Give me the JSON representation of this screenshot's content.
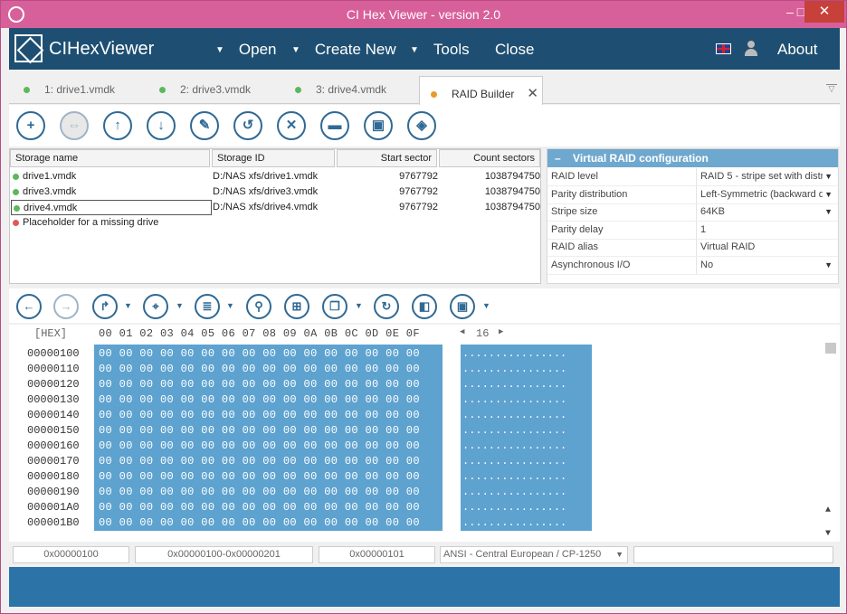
{
  "window": {
    "title": "CI Hex Viewer - version 2.0",
    "min": "–",
    "max": "□",
    "close": "✕"
  },
  "menubar": {
    "brand": "CIHexViewer",
    "open": "Open",
    "create_new": "Create New",
    "tools": "Tools",
    "close": "Close",
    "about": "About",
    "caret": "▼"
  },
  "tabs": [
    {
      "label": "1: drive1.vmdk"
    },
    {
      "label": "2: drive3.vmdk"
    },
    {
      "label": "3: drive4.vmdk"
    },
    {
      "label": "RAID Builder",
      "close": "✕"
    }
  ],
  "raid_toolbar": {
    "icons": [
      "plus-icon",
      "link-icon",
      "arrow-up-icon",
      "arrow-down-icon",
      "edit-icon",
      "undo-icon",
      "remove-icon",
      "folder-icon",
      "save-icon",
      "layers-icon"
    ],
    "glyphs": [
      "+",
      "⇔",
      "↑",
      "↓",
      "✎",
      "↺",
      "✕",
      "▬",
      "▣",
      "◈"
    ]
  },
  "storage_grid": {
    "headers": [
      "Storage name",
      "Storage ID",
      "Start sector",
      "Count sectors"
    ],
    "rows": [
      {
        "name": "drive1.vmdk",
        "id": "D:/NAS xfs/drive1.vmdk",
        "start": "9767792",
        "count": "1038794750",
        "status_color": "#5cb85c"
      },
      {
        "name": "drive3.vmdk",
        "id": "D:/NAS xfs/drive3.vmdk",
        "start": "9767792",
        "count": "1038794750",
        "status_color": "#5cb85c"
      },
      {
        "name": "drive4.vmdk",
        "id": "D:/NAS xfs/drive4.vmdk",
        "start": "9767792",
        "count": "1038794750",
        "status_color": "#5cb85c"
      },
      {
        "name": "Placeholder for a missing drive",
        "id": "",
        "start": "",
        "count": "",
        "status_color": "#e05a5a"
      }
    ]
  },
  "raid_config": {
    "collapse": "–",
    "title": "Virtual RAID configuration",
    "props": [
      {
        "label": "RAID level",
        "value": "RAID 5 - stripe set with distr",
        "dropdown": "▼"
      },
      {
        "label": "Parity distribution",
        "value": "Left-Symmetric (backward dy",
        "dropdown": "▼"
      },
      {
        "label": "Stripe size",
        "value": "64KB",
        "dropdown": "▼"
      },
      {
        "label": "Parity delay",
        "value": "1",
        "dropdown": ""
      },
      {
        "label": "RAID alias",
        "value": "Virtual RAID",
        "dropdown": ""
      },
      {
        "label": "Asynchronous I/O",
        "value": "No",
        "dropdown": "▼"
      }
    ]
  },
  "hex_toolbar": {
    "glyphs": [
      "←",
      "→",
      "↱",
      "▼",
      "⌖",
      "▼",
      "≣",
      "▼",
      "⚲",
      "⊞",
      "❐",
      "▼",
      "↻",
      "◧",
      "▣",
      "▼"
    ]
  },
  "hex": {
    "mode": "[HEX]",
    "columns": [
      "00",
      "01",
      "02",
      "03",
      "04",
      "05",
      "06",
      "07",
      "08",
      "09",
      "0A",
      "0B",
      "0C",
      "0D",
      "0E",
      "0F"
    ],
    "width_left": "◀",
    "width": "16",
    "width_right": "▶",
    "addresses": [
      "00000100",
      "00000110",
      "00000120",
      "00000130",
      "00000140",
      "00000150",
      "00000160",
      "00000170",
      "00000180",
      "00000190",
      "000001A0",
      "000001B0"
    ],
    "row_bytes": "00 00 00 00 00 00 00 00 00 00 00 00 00 00 00 00",
    "ascii_row": "................",
    "scroll_up": "▲",
    "scroll_down": "▼"
  },
  "status": {
    "offset": "0x00000100",
    "range": "0x00000100-0x00000201",
    "length": "0x00000101",
    "encoding": "ANSI - Central European / CP-1250",
    "dropdown": "▼"
  }
}
